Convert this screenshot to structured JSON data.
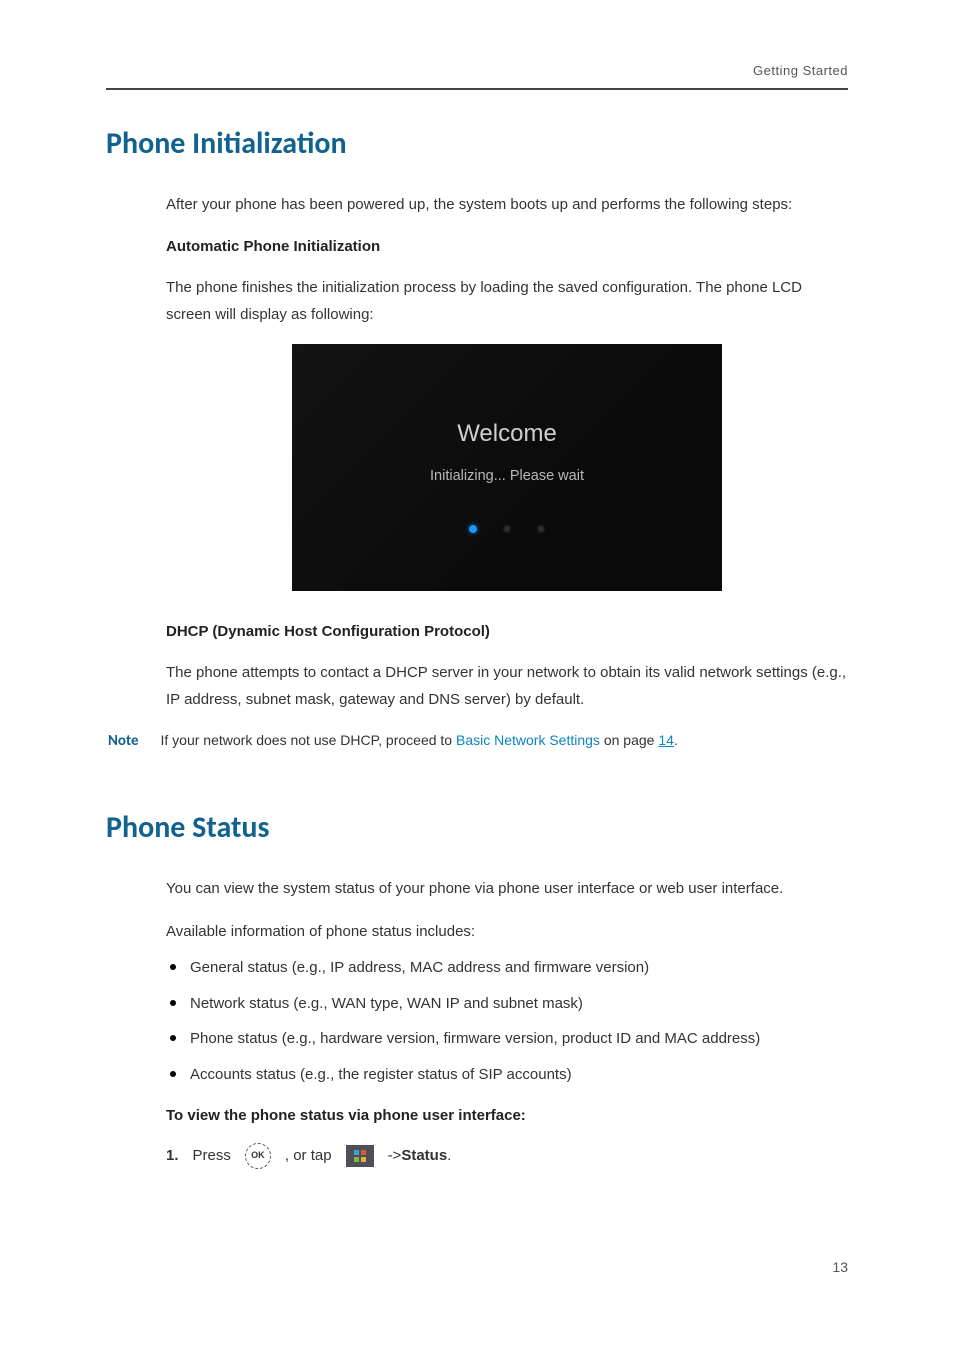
{
  "header": {
    "running": "Getting Started"
  },
  "section1": {
    "title": "Phone Initialization",
    "intro": "After your phone has been powered up, the system boots up and performs the following steps:",
    "sub1": "Automatic Phone Initialization",
    "para1": "The phone finishes the initialization process by loading the saved configuration. The phone LCD screen will display as following:",
    "screen": {
      "welcome": "Welcome",
      "sub": "Initializing... Please wait"
    },
    "sub2": "DHCP (Dynamic Host Configuration Protocol)",
    "para2": "The phone attempts to contact a DHCP server in your network to obtain its valid network settings (e.g., IP address, subnet mask, gateway and DNS server) by default."
  },
  "note": {
    "label": "Note",
    "prefix": "If your network does not use DHCP, proceed to ",
    "link_text": "Basic Network Settings",
    "middle": " on page ",
    "page": "14",
    "suffix": "."
  },
  "section2": {
    "title": "Phone Status",
    "intro": "You can view the system status of your phone via phone user interface or web user interface.",
    "avail": "Available information of phone status includes:",
    "bullets": [
      "General status (e.g., IP address, MAC address and firmware version)",
      "Network status (e.g., WAN type, WAN IP and subnet mask)",
      "Phone status (e.g., hardware version, firmware version, product ID and MAC address)",
      "Accounts status (e.g., the register status of SIP accounts)"
    ],
    "howto": "To view the phone status via phone user interface:",
    "step": {
      "num": "1.",
      "press": "Press",
      "ok": "OK",
      "or_tap": ", or tap",
      "arrow": "->",
      "status": "Status",
      "period": "."
    }
  },
  "page_number": "13"
}
